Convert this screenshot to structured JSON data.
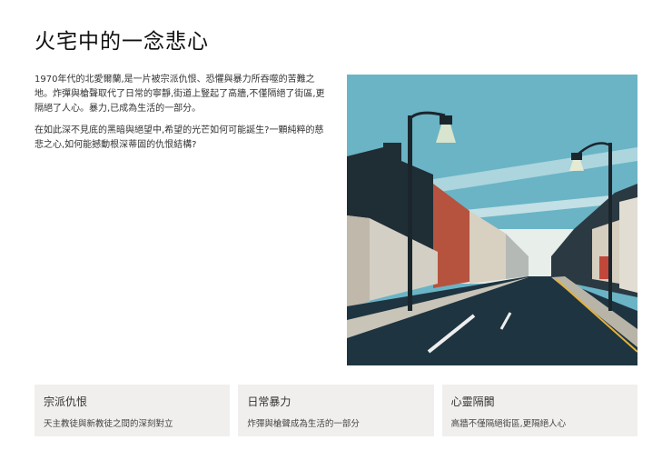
{
  "title": "火宅中的一念悲心",
  "paragraphs": [
    "1970年代的北愛爾蘭,是一片被宗派仇恨、恐懼與暴力所吞噬的苦難之地。炸彈與槍聲取代了日常的寧靜,街道上豎起了高牆,不僅隔絕了街區,更隔絕了人心。暴力,已成為生活的一部分。",
    "在如此深不見底的黑暗與絕望中,希望的光芒如何可能誕生?一顆純粹的慈悲之心,如何能撼動根深蒂固的仇恨結構?"
  ],
  "cards": [
    {
      "title": "宗派仇恨",
      "desc": "天主教徒與新教徒之間的深刻對立"
    },
    {
      "title": "日常暴力",
      "desc": "炸彈與槍聲成為生活的一部分"
    },
    {
      "title": "心靈隔閡",
      "desc": "高牆不僅隔絕街區,更隔絕人心"
    }
  ]
}
